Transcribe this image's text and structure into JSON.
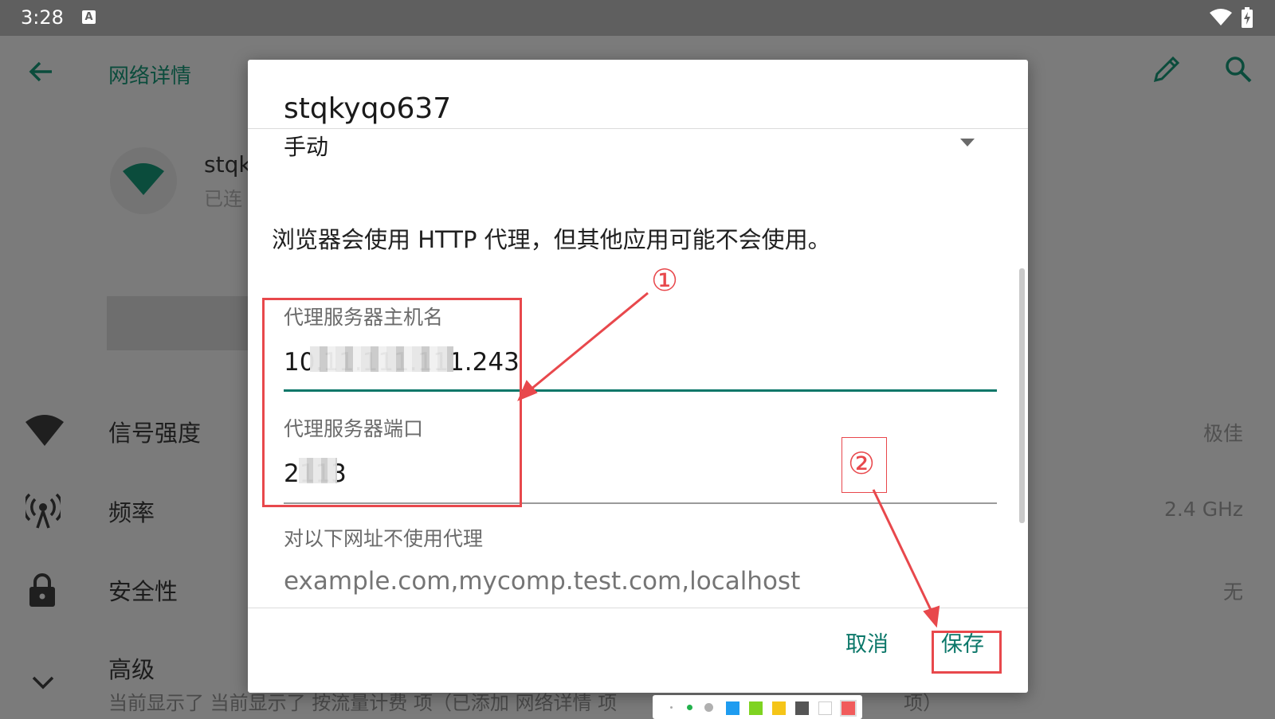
{
  "status_bar": {
    "time": "3:28",
    "badge": "A",
    "icons": [
      "wifi-icon",
      "battery-charging-icon"
    ]
  },
  "app_bar": {
    "title": "网络详情",
    "icons": [
      "back-arrow-icon",
      "edit-pencil-icon",
      "search-icon"
    ]
  },
  "network_header": {
    "name": "stqk",
    "status": "已连"
  },
  "rows": [
    {
      "label": "信号强度",
      "value": "极佳",
      "icon": "signal-strength-icon"
    },
    {
      "label": "频率",
      "value": "2.4 GHz",
      "icon": "antenna-frequency-icon"
    },
    {
      "label": "安全性",
      "value": "无",
      "icon": "lock-icon"
    }
  ],
  "advanced": {
    "label": "高级",
    "subtext": "当前显示了 当前显示了 按流量计费 项（已添加 网络详情 项",
    "subtext_tail": "项）",
    "icon": "chevron-down-icon"
  },
  "dialog": {
    "title": "stqkyqo637",
    "proxy_mode": "手动",
    "note": "浏览器会使用 HTTP 代理，但其他应用可能不会使用。",
    "host_label": "代理服务器主机名",
    "host_value": "10.11.111.111.243",
    "port_label": "代理服务器端口",
    "port_value": "2113",
    "bypass_label": "对以下网址不使用代理",
    "bypass_placeholder": "example.com,mycomp.test.com,localhost",
    "cancel": "取消",
    "save": "保存"
  },
  "annotations": {
    "callout_1": "①",
    "callout_2": "②",
    "color": "#e8484c"
  },
  "palette_colors": [
    "#aaaaaa",
    "#22b14c",
    "#b0b0b0",
    "#1e9cf0",
    "#7ed321",
    "#f5c518",
    "#555555",
    "#ffffff",
    "#f15b5b"
  ],
  "colors": {
    "accent": "#0b7769",
    "scrim": "#7b7b7b"
  }
}
